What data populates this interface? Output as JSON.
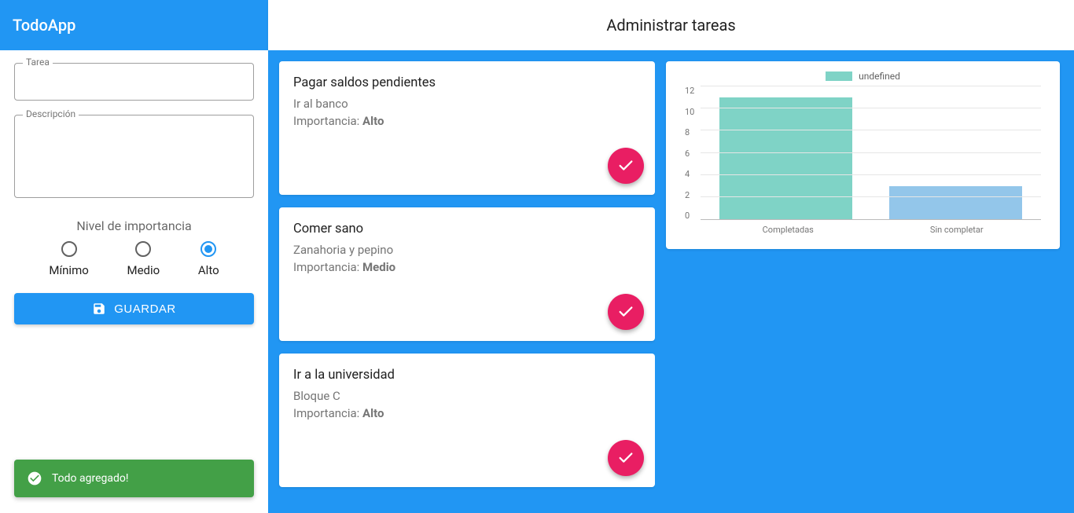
{
  "header": {
    "app_title": "TodoApp",
    "main_title": "Administrar tareas"
  },
  "form": {
    "task_label": "Tarea",
    "task_value": "",
    "desc_label": "Descripción",
    "desc_value": "",
    "importance_title": "Nivel de importancia",
    "radios": [
      {
        "key": "min",
        "label": "Mínimo",
        "selected": false
      },
      {
        "key": "med",
        "label": "Medio",
        "selected": false
      },
      {
        "key": "alto",
        "label": "Alto",
        "selected": true
      }
    ],
    "save_label": "GUARDAR"
  },
  "snackbar": {
    "message": "Todo agregado!"
  },
  "tasks": [
    {
      "title": "Pagar saldos pendientes",
      "subtitle": "Ir al banco",
      "importance_label": "Importancia:",
      "importance_value": "Alto"
    },
    {
      "title": "Comer sano",
      "subtitle": "Zanahoria y pepino",
      "importance_label": "Importancia:",
      "importance_value": "Medio"
    },
    {
      "title": "Ir a la universidad",
      "subtitle": "Bloque C",
      "importance_label": "Importancia:",
      "importance_value": "Alto"
    }
  ],
  "chart_data": {
    "type": "bar",
    "legend_label": "undefined",
    "categories": [
      "Completadas",
      "Sin completar"
    ],
    "values": [
      11,
      3
    ],
    "y_ticks": [
      0,
      2,
      4,
      6,
      8,
      10,
      12
    ],
    "ylim": [
      0,
      12
    ],
    "colors": [
      "#7fd3c6",
      "#93c6ea"
    ]
  }
}
